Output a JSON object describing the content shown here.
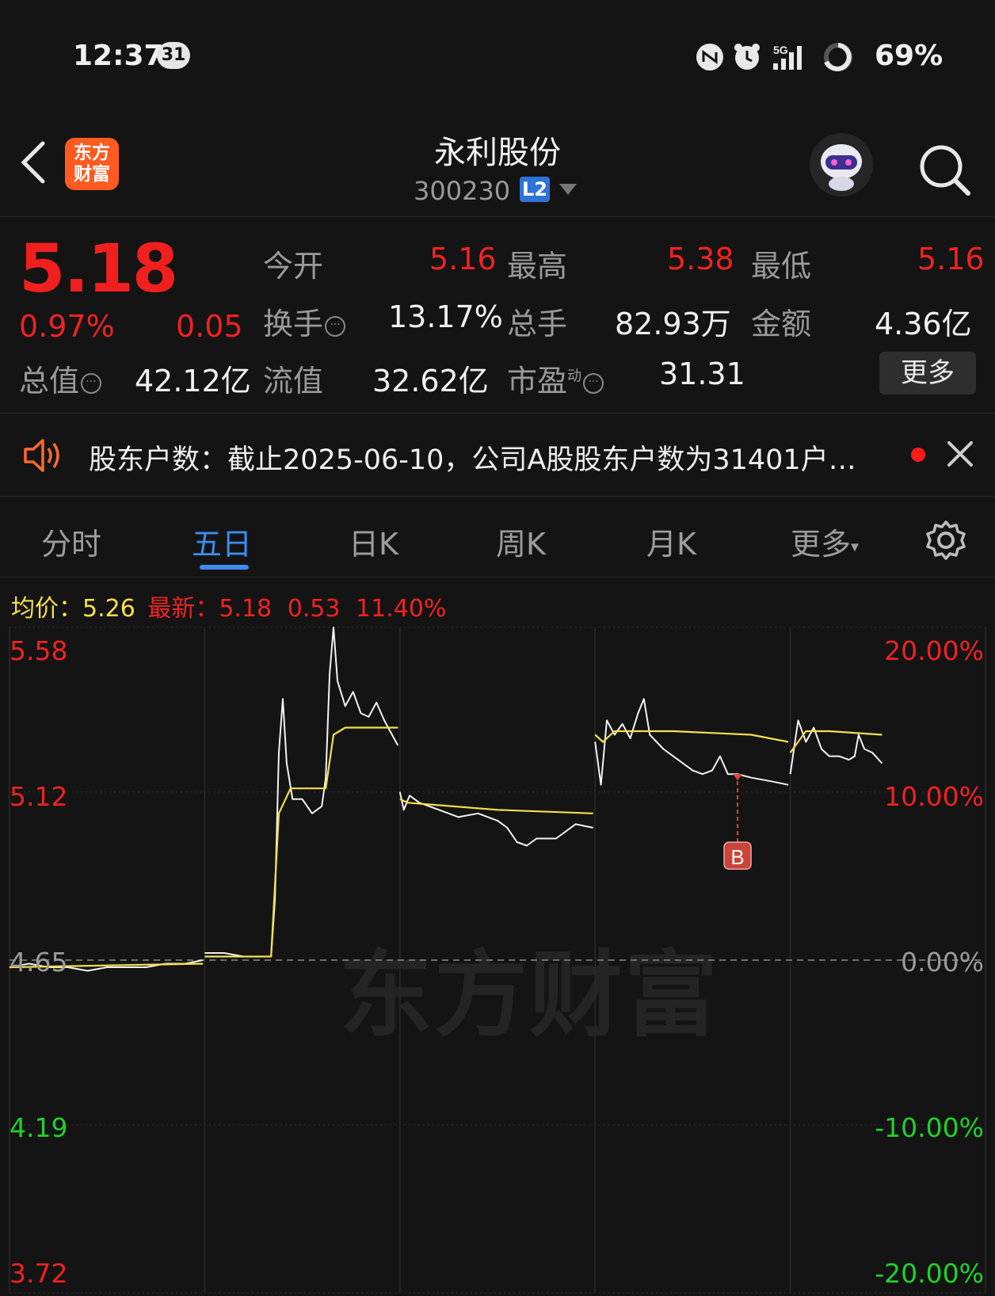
{
  "status_bar": {
    "time": "12:37",
    "calendar_badge": "31",
    "network": "5G",
    "battery": "69%"
  },
  "header": {
    "app_logo_line1": "东方",
    "app_logo_line2": "财富",
    "stock_name": "永利股份",
    "stock_code": "300230",
    "level_badge": "L2"
  },
  "quote": {
    "price": "5.18",
    "change_pct": "0.97%",
    "change": "0.05",
    "open_label": "今开",
    "open": "5.16",
    "high_label": "最高",
    "high": "5.38",
    "low_label": "最低",
    "low": "5.16",
    "turnover_label": "换手",
    "turnover": "13.17%",
    "volume_label": "总手",
    "volume": "82.93万",
    "amount_label": "金额",
    "amount": "4.36亿",
    "mktcap_label": "总值",
    "mktcap": "42.12亿",
    "float_label": "流值",
    "float": "32.62亿",
    "pe_label": "市盈",
    "pe_sup": "动",
    "pe": "31.31",
    "more_button": "更多"
  },
  "notice": {
    "text": "股东户数：截止2025-06-10，公司A股股东户数为31401户…"
  },
  "tabs": [
    {
      "label": "分时",
      "active": false
    },
    {
      "label": "五日",
      "active": true
    },
    {
      "label": "日K",
      "active": false
    },
    {
      "label": "周K",
      "active": false
    },
    {
      "label": "月K",
      "active": false
    },
    {
      "label": "更多",
      "active": false
    }
  ],
  "chart_legend": {
    "avg_label": "均价：",
    "avg_value": "5.26",
    "latest_label": "最新：",
    "latest_value": "5.18",
    "latest_change": "0.53",
    "latest_pct": "11.40%"
  },
  "watermark": "东方财富",
  "chart_data": {
    "type": "line",
    "title": "",
    "x": [
      0,
      0.5,
      1,
      1.5,
      2,
      2.5,
      3,
      3.5,
      4,
      4.5,
      5
    ],
    "days": 5,
    "reference_price": 4.65,
    "y_ticks_left": [
      "5.58",
      "5.12",
      "4.65",
      "4.19",
      "3.72"
    ],
    "y_ticks_right": [
      "20.00%",
      "10.00%",
      "0.00%",
      "-10.00%",
      "-20.00%"
    ],
    "ylim": [
      3.72,
      5.58
    ],
    "grid": true,
    "marker": {
      "label": "B",
      "day_position": 3.73,
      "price": 5.17
    },
    "series": [
      {
        "name": "",
        "color": "#f2f2f2",
        "points": [
          [
            0.0,
            4.63
          ],
          [
            0.1,
            4.64
          ],
          [
            0.2,
            4.63
          ],
          [
            0.3,
            4.63
          ],
          [
            0.4,
            4.62
          ],
          [
            0.5,
            4.63
          ],
          [
            0.6,
            4.63
          ],
          [
            0.7,
            4.63
          ],
          [
            0.8,
            4.64
          ],
          [
            0.9,
            4.64
          ],
          [
            0.99,
            4.65
          ],
          [
            1.0,
            4.67
          ],
          [
            1.1,
            4.67
          ],
          [
            1.2,
            4.66
          ],
          [
            1.3,
            4.66
          ],
          [
            1.34,
            4.66
          ],
          [
            1.36,
            4.82
          ],
          [
            1.38,
            5.23
          ],
          [
            1.4,
            5.38
          ],
          [
            1.42,
            5.2
          ],
          [
            1.45,
            5.1
          ],
          [
            1.5,
            5.1
          ],
          [
            1.55,
            5.06
          ],
          [
            1.6,
            5.08
          ],
          [
            1.62,
            5.16
          ],
          [
            1.64,
            5.45
          ],
          [
            1.66,
            5.58
          ],
          [
            1.68,
            5.43
          ],
          [
            1.72,
            5.36
          ],
          [
            1.76,
            5.4
          ],
          [
            1.8,
            5.34
          ],
          [
            1.84,
            5.33
          ],
          [
            1.88,
            5.37
          ],
          [
            1.92,
            5.32
          ],
          [
            1.96,
            5.28
          ],
          [
            1.99,
            5.25
          ],
          [
            2.0,
            5.12
          ],
          [
            2.02,
            5.07
          ],
          [
            2.05,
            5.11
          ],
          [
            2.1,
            5.09
          ],
          [
            2.2,
            5.07
          ],
          [
            2.3,
            5.05
          ],
          [
            2.4,
            5.06
          ],
          [
            2.5,
            5.04
          ],
          [
            2.55,
            5.02
          ],
          [
            2.6,
            4.98
          ],
          [
            2.65,
            4.97
          ],
          [
            2.7,
            4.99
          ],
          [
            2.8,
            4.99
          ],
          [
            2.9,
            5.03
          ],
          [
            2.99,
            5.02
          ],
          [
            3.0,
            5.26
          ],
          [
            3.03,
            5.14
          ],
          [
            3.06,
            5.32
          ],
          [
            3.1,
            5.28
          ],
          [
            3.14,
            5.31
          ],
          [
            3.18,
            5.27
          ],
          [
            3.22,
            5.34
          ],
          [
            3.25,
            5.38
          ],
          [
            3.28,
            5.28
          ],
          [
            3.35,
            5.24
          ],
          [
            3.4,
            5.22
          ],
          [
            3.45,
            5.2
          ],
          [
            3.5,
            5.18
          ],
          [
            3.55,
            5.17
          ],
          [
            3.6,
            5.18
          ],
          [
            3.64,
            5.22
          ],
          [
            3.68,
            5.17
          ],
          [
            3.73,
            5.17
          ],
          [
            3.8,
            5.16
          ],
          [
            3.9,
            5.15
          ],
          [
            3.99,
            5.14
          ],
          [
            4.0,
            5.17
          ],
          [
            4.04,
            5.32
          ],
          [
            4.08,
            5.26
          ],
          [
            4.12,
            5.3
          ],
          [
            4.16,
            5.24
          ],
          [
            4.2,
            5.22
          ],
          [
            4.25,
            5.22
          ],
          [
            4.3,
            5.21
          ],
          [
            4.33,
            5.22
          ],
          [
            4.35,
            5.28
          ],
          [
            4.38,
            5.24
          ],
          [
            4.42,
            5.23
          ],
          [
            4.47,
            5.2
          ]
        ]
      },
      {
        "name": "",
        "color": "#f5e04a",
        "points": [
          [
            0.0,
            4.63
          ],
          [
            0.99,
            4.64
          ],
          [
            1.0,
            4.66
          ],
          [
            1.34,
            4.66
          ],
          [
            1.38,
            5.06
          ],
          [
            1.44,
            5.13
          ],
          [
            1.62,
            5.13
          ],
          [
            1.66,
            5.28
          ],
          [
            1.72,
            5.3
          ],
          [
            1.99,
            5.3
          ],
          [
            2.0,
            5.1
          ],
          [
            2.04,
            5.09
          ],
          [
            2.5,
            5.07
          ],
          [
            2.99,
            5.06
          ],
          [
            3.0,
            5.28
          ],
          [
            3.04,
            5.26
          ],
          [
            3.1,
            5.29
          ],
          [
            3.4,
            5.29
          ],
          [
            3.8,
            5.28
          ],
          [
            3.99,
            5.26
          ],
          [
            4.0,
            5.23
          ],
          [
            4.08,
            5.29
          ],
          [
            4.2,
            5.29
          ],
          [
            4.47,
            5.28
          ]
        ]
      }
    ]
  }
}
